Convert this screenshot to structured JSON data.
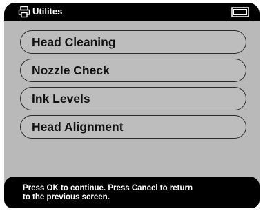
{
  "header": {
    "title": "Utilites",
    "printer_icon": "printer-icon",
    "battery_icon": "battery-icon"
  },
  "menu": {
    "items": [
      {
        "label": "Head Cleaning"
      },
      {
        "label": "Nozzle Check"
      },
      {
        "label": "Ink Levels"
      },
      {
        "label": "Head Alignment"
      }
    ]
  },
  "footer": {
    "line1": "Press OK to continue. Press Cancel to return",
    "line2": "to the previous screen."
  },
  "colors": {
    "screen_background": "#b9b9b9",
    "bar_background": "#000000",
    "button_border": "#2a2a2a",
    "text_dark": "#111111",
    "text_light": "#ffffff"
  }
}
